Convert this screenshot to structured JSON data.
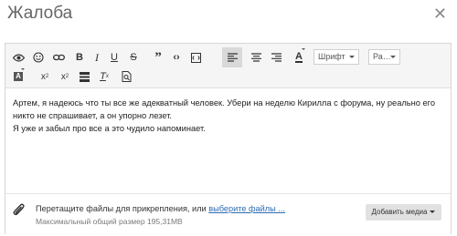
{
  "window": {
    "title": "Жалоба"
  },
  "toolbar": {
    "font_select": "Шрифт",
    "size_select": "Ра…"
  },
  "content": {
    "line1": "Артем, я надеюсь что ты все же адекватный человек. Убери на неделю Кирилла с форума, ну реально его никто не спрашивает, а он упорно лезет.",
    "line2": "Я уже и забыл про все а это чудило напоминает."
  },
  "attachments": {
    "drop_text": "Перетащите файлы для прикрепления, или ",
    "select_link": "выберите файлы ...",
    "max_label": "Максимальный общий размер ",
    "max_value": "195,31MB",
    "media_button": "Добавить медиа"
  }
}
